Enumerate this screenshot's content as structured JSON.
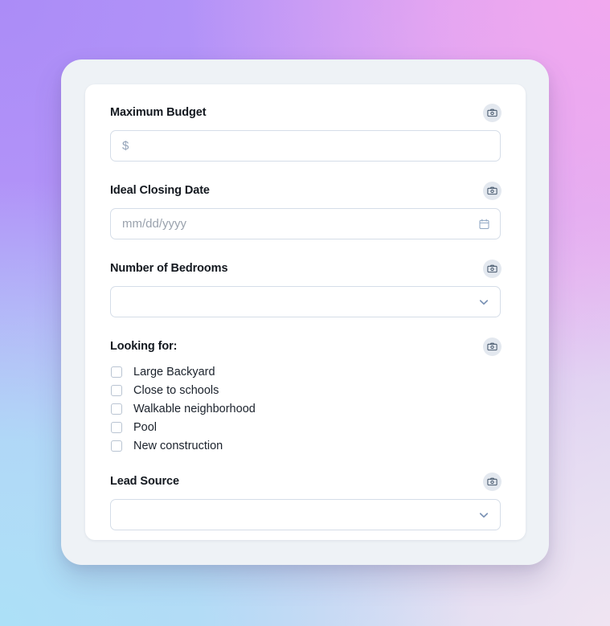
{
  "theme": {
    "panel_bg": "#eef2f6",
    "card_bg": "#ffffff",
    "border": "#d5dde8",
    "label_color": "#13181f",
    "placeholder_color": "#9aa2ad",
    "accent_icon": "#7b93b5",
    "capture_btn_bg": "#e3e8ef",
    "gradient_top_left": "#ab8cf7",
    "gradient_top_right": "#f2a8ef",
    "gradient_bottom_left": "#ace0f7",
    "gradient_bottom_right": "#f0e4f2"
  },
  "form": {
    "fields": [
      {
        "id": "maximum-budget",
        "label": "Maximum Budget",
        "type": "text",
        "prefix": "$",
        "value": "",
        "placeholder": "",
        "capture_icon": "camera-icon"
      },
      {
        "id": "ideal-closing-date",
        "label": "Ideal Closing Date",
        "type": "date",
        "value": "",
        "placeholder": "mm/dd/yyyy",
        "trailing_icon": "calendar-icon",
        "capture_icon": "camera-icon"
      },
      {
        "id": "number-of-bedrooms",
        "label": "Number of Bedrooms",
        "type": "select",
        "value": "",
        "placeholder": "",
        "trailing_icon": "chevron-down-icon",
        "capture_icon": "camera-icon"
      },
      {
        "id": "looking-for",
        "label": "Looking for:",
        "type": "checkbox-group",
        "capture_icon": "camera-icon",
        "options": [
          {
            "label": "Large Backyard",
            "checked": false
          },
          {
            "label": "Close to schools",
            "checked": false
          },
          {
            "label": "Walkable neighborhood",
            "checked": false
          },
          {
            "label": "Pool",
            "checked": false
          },
          {
            "label": "New construction",
            "checked": false
          }
        ]
      },
      {
        "id": "lead-source",
        "label": "Lead Source",
        "type": "select",
        "value": "",
        "placeholder": "",
        "trailing_icon": "chevron-down-icon",
        "capture_icon": "camera-icon"
      }
    ]
  }
}
